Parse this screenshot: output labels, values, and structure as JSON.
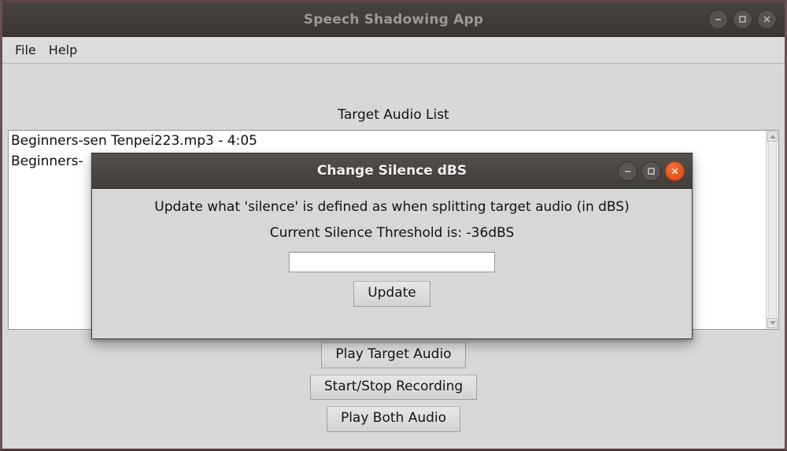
{
  "window": {
    "title": "Speech Shadowing App",
    "controls": [
      {
        "name": "minimize-button",
        "icon": "minimize-icon"
      },
      {
        "name": "maximize-button",
        "icon": "maximize-icon"
      },
      {
        "name": "close-button",
        "icon": "close-icon"
      }
    ]
  },
  "menubar": {
    "items": [
      {
        "label": "File"
      },
      {
        "label": "Help"
      }
    ]
  },
  "main": {
    "list_label": "Target Audio List",
    "list_items": [
      {
        "text": "Beginners-sen Tenpei223.mp3 - 4:05"
      },
      {
        "text": "Beginners-"
      }
    ],
    "buttons": [
      {
        "label": "Play Target Audio"
      },
      {
        "label": "Start/Stop Recording"
      },
      {
        "label": "Play Both Audio"
      }
    ]
  },
  "dialog": {
    "title": "Change Silence dBS",
    "description": "Update what 'silence' is defined as when splitting target audio (in dBS)",
    "current_value_text": "Current Silence Threshold is: -36dBS",
    "input_value": "",
    "input_placeholder": "",
    "update_label": "Update"
  },
  "colors": {
    "accent_close": "#e25419",
    "window_frame": "#5d4449",
    "titlebar": "#403c39",
    "dialog_titlebar": "#4b4743",
    "surface": "#d8d8d8"
  }
}
